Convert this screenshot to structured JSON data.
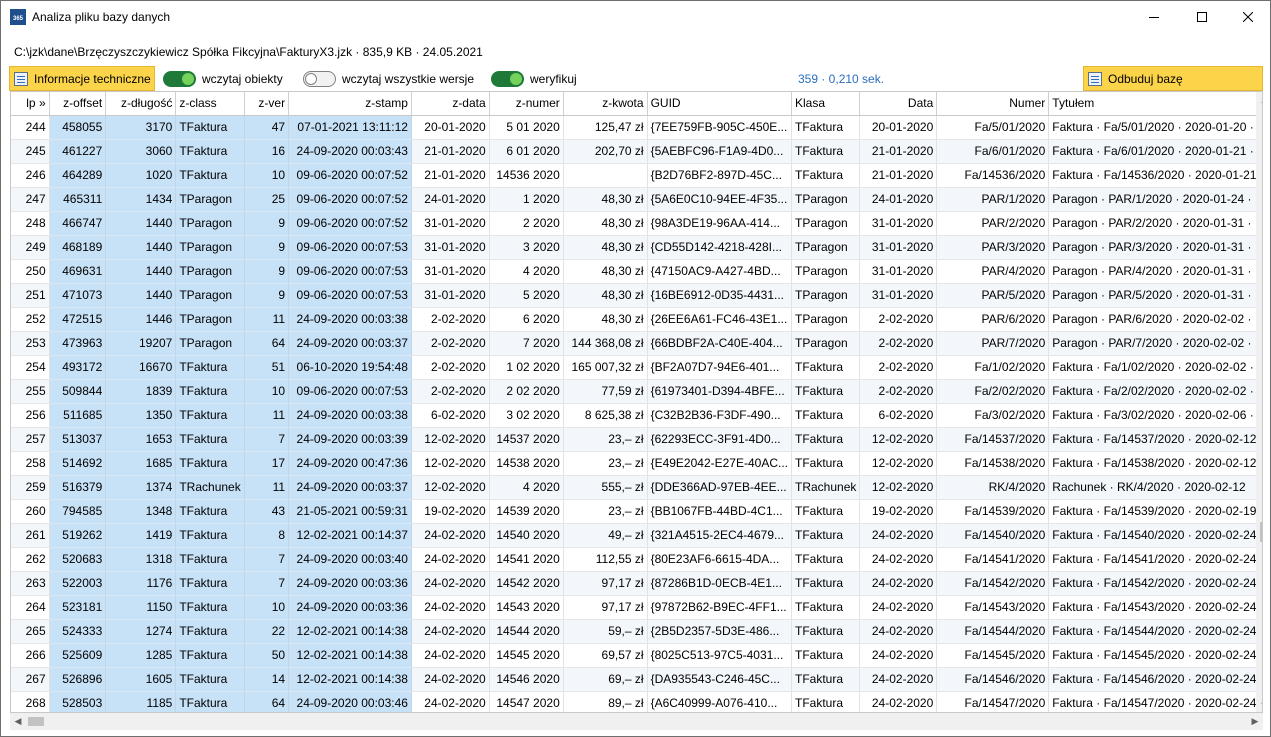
{
  "window": {
    "title": "Analiza pliku bazy danych",
    "icon_text": "365",
    "minimize_icon": "minimize-icon",
    "maximize_icon": "maximize-icon",
    "close_icon": "close-icon"
  },
  "file_info": "C:\\jzk\\dane\\Brzęczyszczykiewicz Spółka Fikcyjna\\FakturyX3.jzk · 835,9 KB · 24.05.2021",
  "toolbar": {
    "info_button": "Informacje techniczne",
    "toggles": [
      {
        "label": "wczytaj obiekty",
        "on": true
      },
      {
        "label": "wczytaj wszystkie wersje",
        "on": false
      },
      {
        "label": "weryfikuj",
        "on": true
      }
    ],
    "stats": "359 · 0,210 sek.",
    "rebuild_button": "Odbuduj bazę",
    "accent_color": "#fbd449",
    "toggle_on_color": "#1f7a3a",
    "stats_color": "#2a6ebf"
  },
  "table": {
    "columns": [
      "lp »",
      "z-offset",
      "z-długość",
      "z-class",
      "z-ver",
      "z-stamp",
      "z-data",
      "z-numer",
      "z-kwota",
      "GUID",
      "Klasa",
      "Data",
      "Numer",
      "Tytułem"
    ],
    "rows": [
      [
        "244",
        "458055",
        "3170",
        "TFaktura",
        "47",
        "07-01-2021 13:11:12",
        "20-01-2020",
        "5 01 2020",
        "125,47 zł",
        "{7EE759FB-905C-450E...",
        "TFaktura",
        "20-01-2020",
        "Fa/5/01/2020",
        "Faktura · Fa/5/01/2020 · 2020-01-20 ·"
      ],
      [
        "245",
        "461227",
        "3060",
        "TFaktura",
        "16",
        "24-09-2020 00:03:43",
        "21-01-2020",
        "6 01 2020",
        "202,70 zł",
        "{5AEBFC96-F1A9-4D0...",
        "TFaktura",
        "21-01-2020",
        "Fa/6/01/2020",
        "Faktura · Fa/6/01/2020 · 2020-01-21 ·"
      ],
      [
        "246",
        "464289",
        "1020",
        "TFaktura",
        "10",
        "09-06-2020 00:07:52",
        "21-01-2020",
        "14536 2020",
        "",
        "{B2D76BF2-897D-45C...",
        "TFaktura",
        "21-01-2020",
        "Fa/14536/2020",
        "Faktura · Fa/14536/2020 · 2020-01-21"
      ],
      [
        "247",
        "465311",
        "1434",
        "TParagon",
        "25",
        "09-06-2020 00:07:52",
        "24-01-2020",
        "1 2020",
        "48,30 zł",
        "{5A6E0C10-94EE-4F35...",
        "TParagon",
        "24-01-2020",
        "PAR/1/2020",
        "Paragon · PAR/1/2020 · 2020-01-24 ·"
      ],
      [
        "248",
        "466747",
        "1440",
        "TParagon",
        "9",
        "09-06-2020 00:07:52",
        "31-01-2020",
        "2 2020",
        "48,30 zł",
        "{98A3DE19-96AA-414...",
        "TParagon",
        "31-01-2020",
        "PAR/2/2020",
        "Paragon · PAR/2/2020 · 2020-01-31 ·"
      ],
      [
        "249",
        "468189",
        "1440",
        "TParagon",
        "9",
        "09-06-2020 00:07:53",
        "31-01-2020",
        "3 2020",
        "48,30 zł",
        "{CD55D142-4218-428I...",
        "TParagon",
        "31-01-2020",
        "PAR/3/2020",
        "Paragon · PAR/3/2020 · 2020-01-31 ·"
      ],
      [
        "250",
        "469631",
        "1440",
        "TParagon",
        "9",
        "09-06-2020 00:07:53",
        "31-01-2020",
        "4 2020",
        "48,30 zł",
        "{47150AC9-A427-4BD...",
        "TParagon",
        "31-01-2020",
        "PAR/4/2020",
        "Paragon · PAR/4/2020 · 2020-01-31 ·"
      ],
      [
        "251",
        "471073",
        "1440",
        "TParagon",
        "9",
        "09-06-2020 00:07:53",
        "31-01-2020",
        "5 2020",
        "48,30 zł",
        "{16BE6912-0D35-4431...",
        "TParagon",
        "31-01-2020",
        "PAR/5/2020",
        "Paragon · PAR/5/2020 · 2020-01-31 ·"
      ],
      [
        "252",
        "472515",
        "1446",
        "TParagon",
        "11",
        "24-09-2020 00:03:38",
        "2-02-2020",
        "6 2020",
        "48,30 zł",
        "{26EE6A61-FC46-43E1...",
        "TParagon",
        "2-02-2020",
        "PAR/6/2020",
        "Paragon · PAR/6/2020 · 2020-02-02 ·"
      ],
      [
        "253",
        "473963",
        "19207",
        "TParagon",
        "64",
        "24-09-2020 00:03:37",
        "2-02-2020",
        "7 2020",
        "144 368,08 zł",
        "{66BDBF2A-C40E-404...",
        "TParagon",
        "2-02-2020",
        "PAR/7/2020",
        "Paragon · PAR/7/2020 · 2020-02-02 ·"
      ],
      [
        "254",
        "493172",
        "16670",
        "TFaktura",
        "51",
        "06-10-2020 19:54:48",
        "2-02-2020",
        "1 02 2020",
        "165 007,32 zł",
        "{BF2A07D7-94E6-401...",
        "TFaktura",
        "2-02-2020",
        "Fa/1/02/2020",
        "Faktura · Fa/1/02/2020 · 2020-02-02 ·"
      ],
      [
        "255",
        "509844",
        "1839",
        "TFaktura",
        "10",
        "09-06-2020 00:07:53",
        "2-02-2020",
        "2 02 2020",
        "77,59 zł",
        "{61973401-D394-4BFE...",
        "TFaktura",
        "2-02-2020",
        "Fa/2/02/2020",
        "Faktura · Fa/2/02/2020 · 2020-02-02 ·"
      ],
      [
        "256",
        "511685",
        "1350",
        "TFaktura",
        "11",
        "24-09-2020 00:03:38",
        "6-02-2020",
        "3 02 2020",
        "8 625,38 zł",
        "{C32B2B36-F3DF-490...",
        "TFaktura",
        "6-02-2020",
        "Fa/3/02/2020",
        "Faktura · Fa/3/02/2020 · 2020-02-06 ·"
      ],
      [
        "257",
        "513037",
        "1653",
        "TFaktura",
        "7",
        "24-09-2020 00:03:39",
        "12-02-2020",
        "14537 2020",
        "23,– zł",
        "{62293ECC-3F91-4D0...",
        "TFaktura",
        "12-02-2020",
        "Fa/14537/2020",
        "Faktura · Fa/14537/2020 · 2020-02-12"
      ],
      [
        "258",
        "514692",
        "1685",
        "TFaktura",
        "17",
        "24-09-2020 00:47:36",
        "12-02-2020",
        "14538 2020",
        "23,– zł",
        "{E49E2042-E27E-40AC...",
        "TFaktura",
        "12-02-2020",
        "Fa/14538/2020",
        "Faktura · Fa/14538/2020 · 2020-02-12"
      ],
      [
        "259",
        "516379",
        "1374",
        "TRachunek",
        "11",
        "24-09-2020 00:03:37",
        "12-02-2020",
        "4 2020",
        "555,– zł",
        "{DDE366AD-97EB-4EE...",
        "TRachunek",
        "12-02-2020",
        "RK/4/2020",
        "Rachunek · RK/4/2020 · 2020-02-12"
      ],
      [
        "260",
        "794585",
        "1348",
        "TFaktura",
        "43",
        "21-05-2021 00:59:31",
        "19-02-2020",
        "14539 2020",
        "23,– zł",
        "{BB1067FB-44BD-4C1...",
        "TFaktura",
        "19-02-2020",
        "Fa/14539/2020",
        "Faktura · Fa/14539/2020 · 2020-02-19"
      ],
      [
        "261",
        "519262",
        "1419",
        "TFaktura",
        "8",
        "12-02-2021 00:14:37",
        "24-02-2020",
        "14540 2020",
        "49,– zł",
        "{321A4515-2EC4-4679...",
        "TFaktura",
        "24-02-2020",
        "Fa/14540/2020",
        "Faktura · Fa/14540/2020 · 2020-02-24"
      ],
      [
        "262",
        "520683",
        "1318",
        "TFaktura",
        "7",
        "24-09-2020 00:03:40",
        "24-02-2020",
        "14541 2020",
        "112,55 zł",
        "{80E23AF6-6615-4DA...",
        "TFaktura",
        "24-02-2020",
        "Fa/14541/2020",
        "Faktura · Fa/14541/2020 · 2020-02-24"
      ],
      [
        "263",
        "522003",
        "1176",
        "TFaktura",
        "7",
        "24-09-2020 00:03:36",
        "24-02-2020",
        "14542 2020",
        "97,17 zł",
        "{87286B1D-0ECB-4E1...",
        "TFaktura",
        "24-02-2020",
        "Fa/14542/2020",
        "Faktura · Fa/14542/2020 · 2020-02-24"
      ],
      [
        "264",
        "523181",
        "1150",
        "TFaktura",
        "10",
        "24-09-2020 00:03:36",
        "24-02-2020",
        "14543 2020",
        "97,17 zł",
        "{97872B62-B9EC-4FF1...",
        "TFaktura",
        "24-02-2020",
        "Fa/14543/2020",
        "Faktura · Fa/14543/2020 · 2020-02-24"
      ],
      [
        "265",
        "524333",
        "1274",
        "TFaktura",
        "22",
        "12-02-2021 00:14:38",
        "24-02-2020",
        "14544 2020",
        "59,– zł",
        "{2B5D2357-5D3E-486...",
        "TFaktura",
        "24-02-2020",
        "Fa/14544/2020",
        "Faktura · Fa/14544/2020 · 2020-02-24"
      ],
      [
        "266",
        "525609",
        "1285",
        "TFaktura",
        "50",
        "12-02-2021 00:14:38",
        "24-02-2020",
        "14545 2020",
        "69,57 zł",
        "{8025C513-97C5-4031...",
        "TFaktura",
        "24-02-2020",
        "Fa/14545/2020",
        "Faktura · Fa/14545/2020 · 2020-02-24"
      ],
      [
        "267",
        "526896",
        "1605",
        "TFaktura",
        "14",
        "12-02-2021 00:14:38",
        "24-02-2020",
        "14546 2020",
        "69,– zł",
        "{DA935543-C246-45C...",
        "TFaktura",
        "24-02-2020",
        "Fa/14546/2020",
        "Faktura · Fa/14546/2020 · 2020-02-24"
      ],
      [
        "268",
        "528503",
        "1185",
        "TFaktura",
        "64",
        "24-09-2020 00:03:46",
        "24-02-2020",
        "14547 2020",
        "89,– zł",
        "{A6C40999-A076-410...",
        "TFaktura",
        "24-02-2020",
        "Fa/14547/2020",
        "Faktura · Fa/14547/2020 · 2020-02-24"
      ]
    ]
  },
  "scroll": {
    "up_icon": "scroll-up-icon",
    "down_icon": "scroll-down-icon",
    "left_icon": "scroll-left-icon",
    "right_icon": "scroll-right-icon"
  }
}
